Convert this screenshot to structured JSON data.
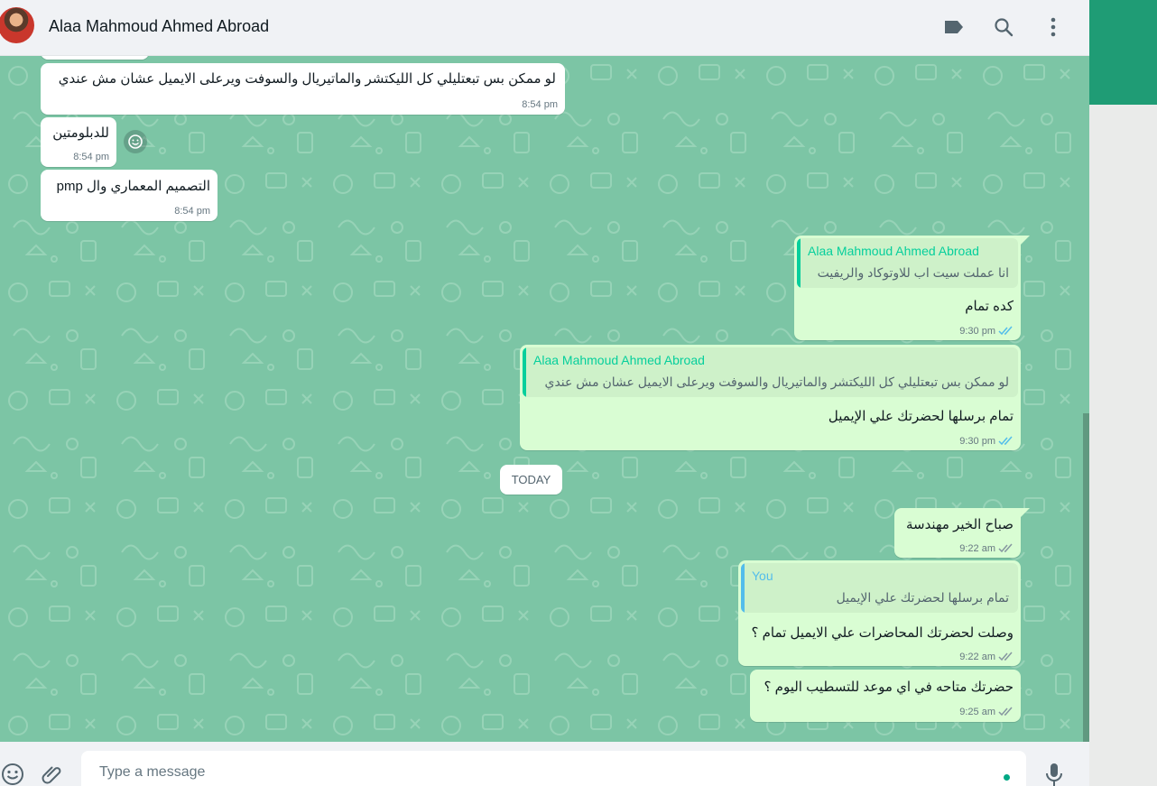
{
  "header": {
    "contact_name": "Alaa Mahmoud Ahmed Abroad",
    "icons": [
      "label-icon",
      "search-icon",
      "menu-icon"
    ]
  },
  "messages": [
    {
      "dir": "in",
      "text": "لو ممكن بس تبعتليلي كل الليكتشر والماتيريال والسوفت ويرعلى الايميل عشان مش عندي",
      "time": "8:54 pm"
    },
    {
      "dir": "in",
      "text": "للدبلومتين",
      "time": "8:54 pm"
    },
    {
      "dir": "in",
      "text": "التصميم المعماري وال pmp",
      "time": "8:54 pm"
    },
    {
      "dir": "out",
      "quote_name": "Alaa Mahmoud Ahmed Abroad",
      "quote_text": "انا عملت سيت اب للاوتوكاد والريفيت",
      "text": "كده تمام",
      "time": "9:30 pm",
      "status": "read"
    },
    {
      "dir": "out",
      "quote_name": "Alaa Mahmoud Ahmed Abroad",
      "quote_text": "لو ممكن بس تبعتليلي كل الليكتشر والماتيريال والسوفت ويرعلى الايميل عشان مش عندي",
      "text": "تمام برسلها لحضرتك علي الإيميل",
      "time": "9:30 pm",
      "status": "read"
    },
    {
      "dir": "out",
      "text": "صباح الخير مهندسة",
      "time": "9:22 am",
      "status": "delivered"
    },
    {
      "dir": "out",
      "quote_name": "You",
      "quote_text": "تمام برسلها لحضرتك علي الإيميل",
      "text": "وصلت لحضرتك المحاضرات علي الايميل تمام ؟",
      "time": "9:22 am",
      "status": "delivered"
    },
    {
      "dir": "out",
      "text": "حضرتك متاحه في اي موعد للتسطيب اليوم ؟",
      "time": "9:25 am",
      "status": "delivered"
    }
  ],
  "date_separator": "TODAY",
  "colors": {
    "chat_bg": "#7cc5a5",
    "outgoing": "#d9fdd3",
    "incoming": "#ffffff",
    "read_ticks": "#53bdeb",
    "delivered_ticks": "#8696a0",
    "quote_contact": "#06cf9c",
    "quote_you": "#53bdeb"
  },
  "composer": {
    "placeholder": "Type a message",
    "icons": [
      "emoji-icon",
      "attach-icon",
      "mic-icon"
    ]
  }
}
